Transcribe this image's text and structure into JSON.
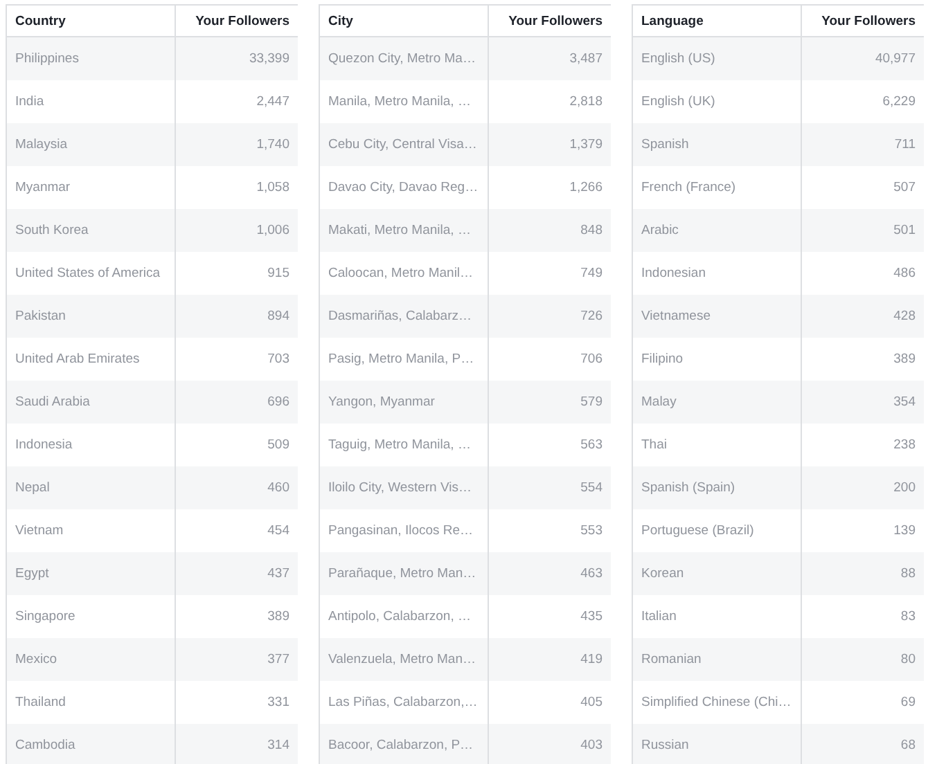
{
  "tables": [
    {
      "columns": [
        "Country",
        "Your Followers"
      ],
      "rows": [
        [
          "Philippines",
          "33,399"
        ],
        [
          "India",
          "2,447"
        ],
        [
          "Malaysia",
          "1,740"
        ],
        [
          "Myanmar",
          "1,058"
        ],
        [
          "South Korea",
          "1,006"
        ],
        [
          "United States of America",
          "915"
        ],
        [
          "Pakistan",
          "894"
        ],
        [
          "United Arab Emirates",
          "703"
        ],
        [
          "Saudi Arabia",
          "696"
        ],
        [
          "Indonesia",
          "509"
        ],
        [
          "Nepal",
          "460"
        ],
        [
          "Vietnam",
          "454"
        ],
        [
          "Egypt",
          "437"
        ],
        [
          "Singapore",
          "389"
        ],
        [
          "Mexico",
          "377"
        ],
        [
          "Thailand",
          "331"
        ],
        [
          "Cambodia",
          "314"
        ]
      ]
    },
    {
      "columns": [
        "City",
        "Your Followers"
      ],
      "rows": [
        [
          "Quezon City, Metro Ma…",
          "3,487"
        ],
        [
          "Manila, Metro Manila, …",
          "2,818"
        ],
        [
          "Cebu City, Central Visa…",
          "1,379"
        ],
        [
          "Davao City, Davao Reg…",
          "1,266"
        ],
        [
          "Makati, Metro Manila, …",
          "848"
        ],
        [
          "Caloocan, Metro Manil…",
          "749"
        ],
        [
          "Dasmariñas, Calabarz…",
          "726"
        ],
        [
          "Pasig, Metro Manila, P…",
          "706"
        ],
        [
          "Yangon, Myanmar",
          "579"
        ],
        [
          "Taguig, Metro Manila, …",
          "563"
        ],
        [
          "Iloilo City, Western Vis…",
          "554"
        ],
        [
          "Pangasinan, Ilocos Re…",
          "553"
        ],
        [
          "Parañaque, Metro Man…",
          "463"
        ],
        [
          "Antipolo, Calabarzon, …",
          "435"
        ],
        [
          "Valenzuela, Metro Man…",
          "419"
        ],
        [
          "Las Piñas, Calabarzon,…",
          "405"
        ],
        [
          "Bacoor, Calabarzon, P…",
          "403"
        ]
      ]
    },
    {
      "columns": [
        "Language",
        "Your Followers"
      ],
      "rows": [
        [
          "English (US)",
          "40,977"
        ],
        [
          "English (UK)",
          "6,229"
        ],
        [
          "Spanish",
          "711"
        ],
        [
          "French (France)",
          "507"
        ],
        [
          "Arabic",
          "501"
        ],
        [
          "Indonesian",
          "486"
        ],
        [
          "Vietnamese",
          "428"
        ],
        [
          "Filipino",
          "389"
        ],
        [
          "Malay",
          "354"
        ],
        [
          "Thai",
          "238"
        ],
        [
          "Spanish (Spain)",
          "200"
        ],
        [
          "Portuguese (Brazil)",
          "139"
        ],
        [
          "Korean",
          "88"
        ],
        [
          "Italian",
          "83"
        ],
        [
          "Romanian",
          "80"
        ],
        [
          "Simplified Chinese (Chi…",
          "69"
        ],
        [
          "Russian",
          "68"
        ]
      ]
    }
  ]
}
